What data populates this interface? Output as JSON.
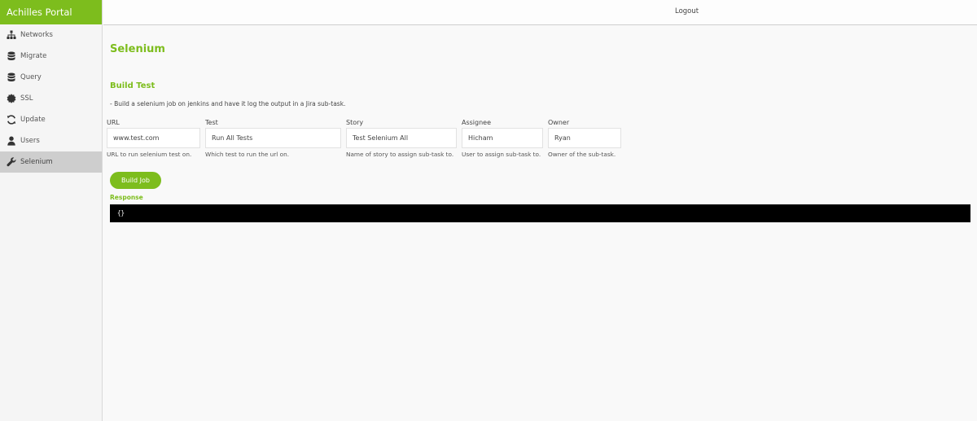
{
  "app": {
    "title": "Achilles Portal"
  },
  "header": {
    "logout_label": "Logout"
  },
  "sidebar": {
    "items": [
      {
        "label": "Networks",
        "icon": "sitemap-icon",
        "active": false
      },
      {
        "label": "Migrate",
        "icon": "database-icon",
        "active": false
      },
      {
        "label": "Query",
        "icon": "database-icon",
        "active": false
      },
      {
        "label": "SSL",
        "icon": "certificate-icon",
        "active": false
      },
      {
        "label": "Update",
        "icon": "refresh-icon",
        "active": false
      },
      {
        "label": "Users",
        "icon": "user-icon",
        "active": false
      },
      {
        "label": "Selenium",
        "icon": "wrench-icon",
        "active": true
      }
    ]
  },
  "page": {
    "title": "Selenium",
    "section_title": "Build Test",
    "description": "- Build a selenium job on jenkins and have it log the output in a Jira sub-task."
  },
  "form": {
    "url": {
      "label": "URL",
      "value": "www.test.com",
      "help": "URL to run selenium test on."
    },
    "test": {
      "label": "Test",
      "value": "Run All Tests",
      "help": "Which test to run the url on."
    },
    "story": {
      "label": "Story",
      "value": "Test Selenium All",
      "help": "Name of story to assign sub-task to."
    },
    "assignee": {
      "label": "Assignee",
      "value": "Hicham",
      "help": "User to assign sub-task to."
    },
    "owner": {
      "label": "Owner",
      "value": "Ryan",
      "help": "Owner of the sub-task."
    },
    "build_button_label": "Build Job"
  },
  "response": {
    "label": "Response",
    "output": "{}"
  },
  "colors": {
    "accent": "#7dbd1d",
    "console_bg": "#000000",
    "active_nav_bg": "#cecece"
  }
}
